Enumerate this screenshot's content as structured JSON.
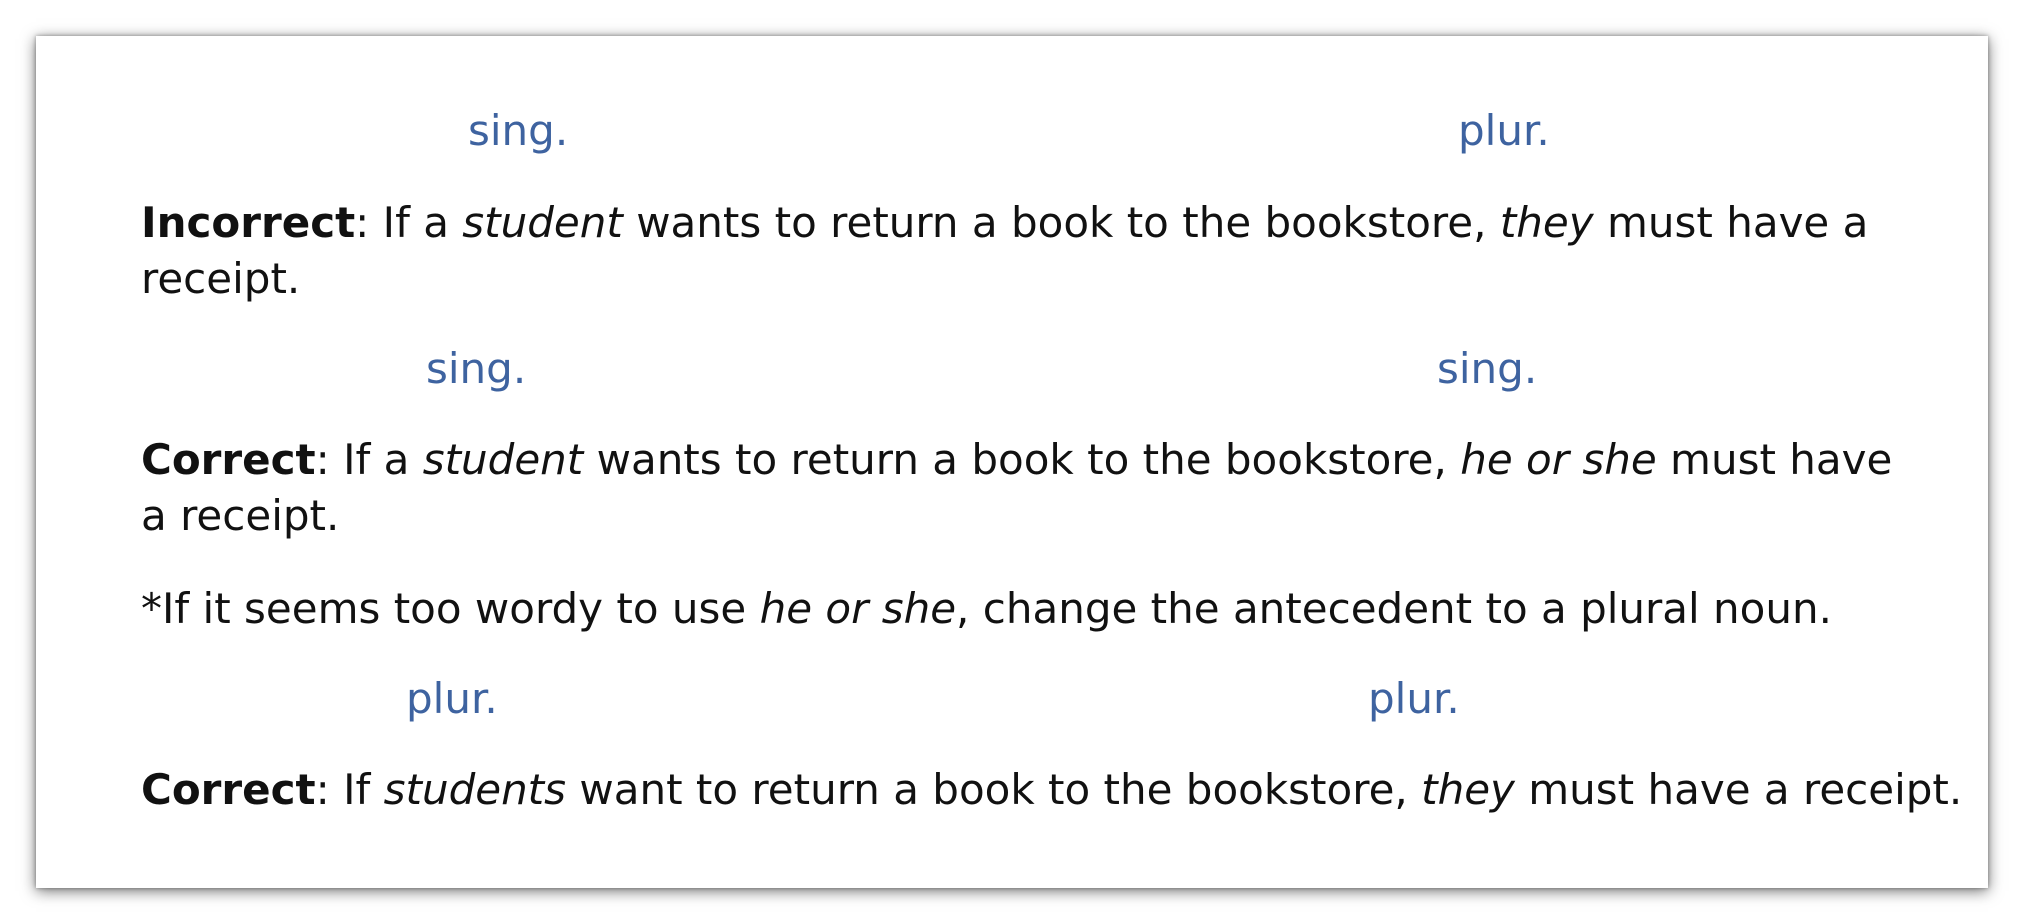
{
  "annotations": {
    "ex1_left": "sing.",
    "ex1_right": "plur.",
    "ex2_left": "sing.",
    "ex2_right": "sing.",
    "ex3_left": "plur.",
    "ex3_right": "plur."
  },
  "example1": {
    "verdict": "Incorrect",
    "colon": ":",
    "part1": " If a ",
    "antecedent": "student",
    "part2": " wants to return a book to the bookstore, ",
    "pronoun": "they",
    "part3": " must have a",
    "part4": "receipt."
  },
  "example2": {
    "verdict": "Correct",
    "colon": ":",
    "part1": " If a ",
    "antecedent": "student",
    "part2": " wants to return a book to the bookstore, ",
    "pronoun": "he or she",
    "part3": " must have",
    "part4": "a receipt."
  },
  "note": {
    "part1": "*If it seems too wordy to use ",
    "emphasis": "he or she",
    "part2": ", change the antecedent to a plural noun."
  },
  "example3": {
    "verdict": "Correct",
    "colon": ":",
    "part1": " If ",
    "antecedent": "students",
    "part2": " want to return a book to the bookstore, ",
    "pronoun": "they",
    "part3": " must have a receipt."
  },
  "colors": {
    "annotation": "#3e63a0",
    "text": "#111111"
  }
}
